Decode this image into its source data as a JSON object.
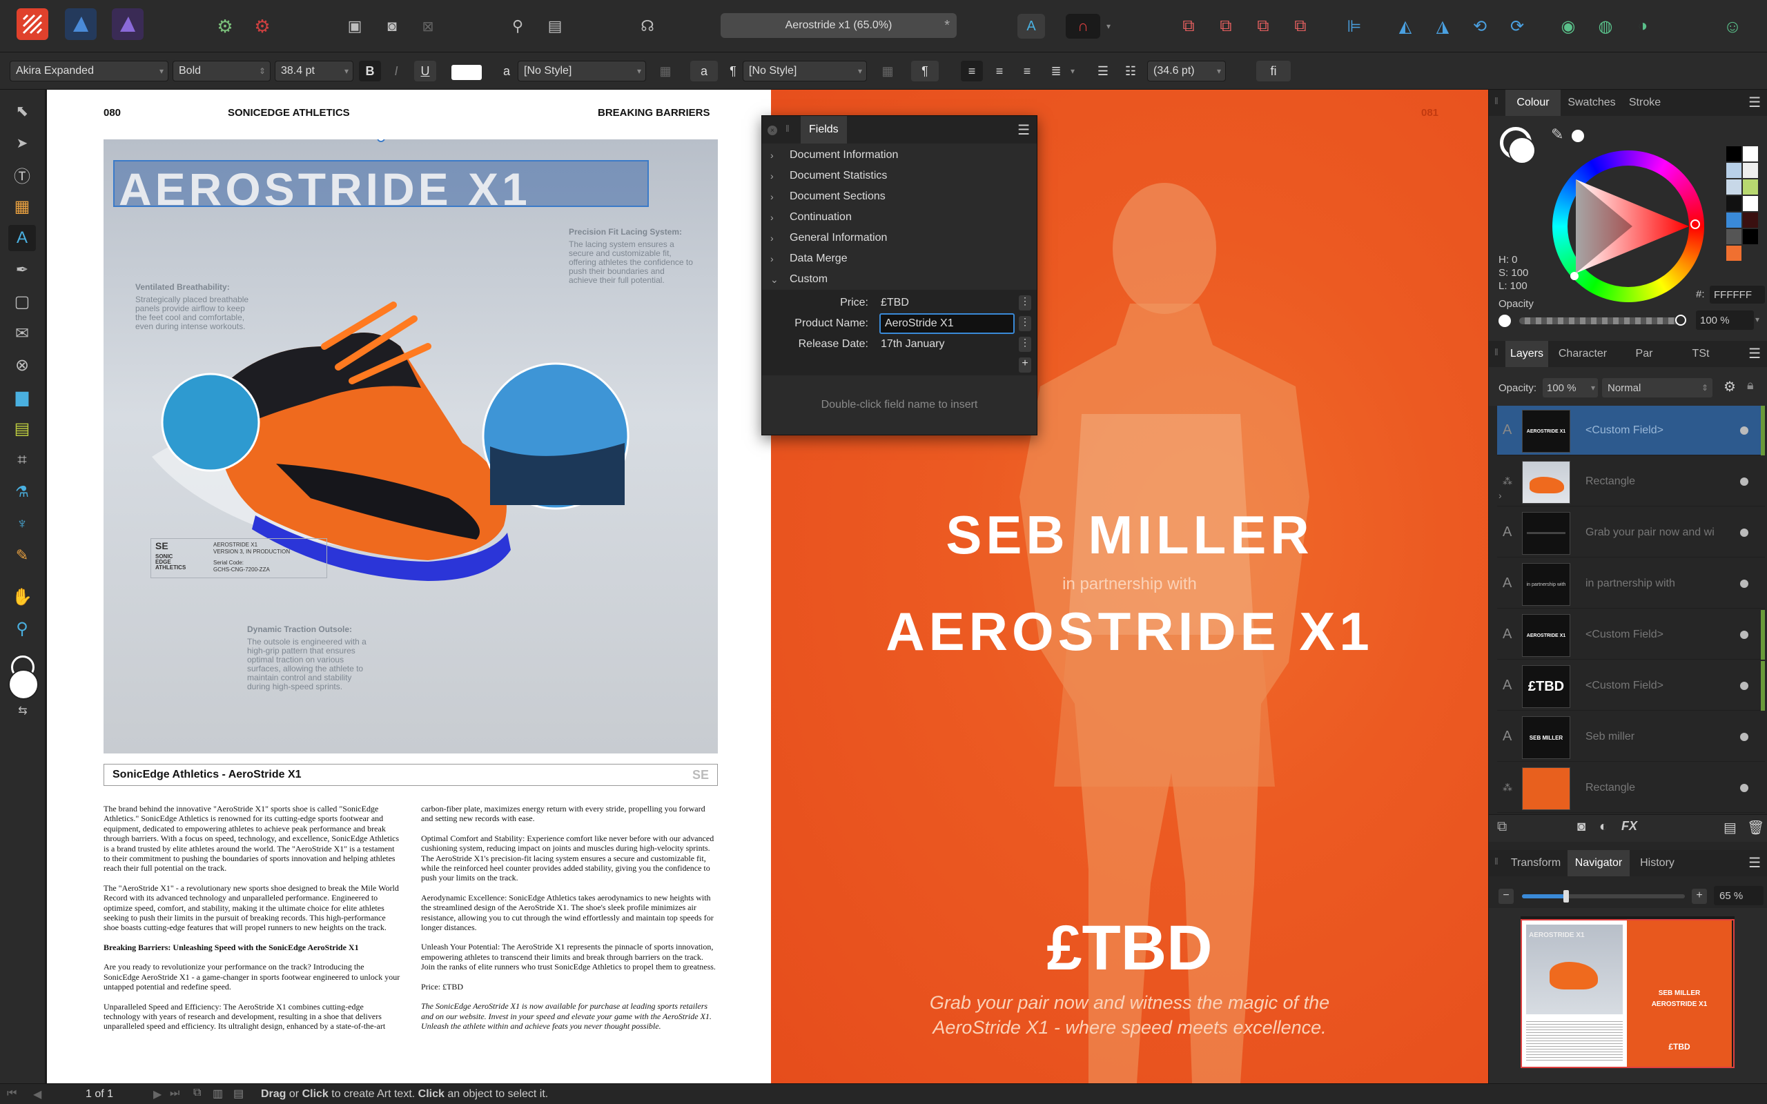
{
  "app": {
    "doc_title": "Aerostride x1 (65.0%)"
  },
  "context": {
    "font": "Akira Expanded",
    "weight": "Bold",
    "size": "38.4 pt",
    "char_style": "[No Style]",
    "para_style": "[No Style]",
    "leading": "(34.6 pt)",
    "bold": "B",
    "italic": "I",
    "underline": "U",
    "a_glyph": "a",
    "pilcrow": "¶",
    "fi": "fi"
  },
  "page_left": {
    "page_num": "080",
    "brand": "SONICEDGE ATHLETICS",
    "section": "BREAKING BARRIERS",
    "hero_title": "AEROSTRIDE X1",
    "callouts": [
      {
        "title": "Ventilated Breathability:",
        "body": "Strategically placed breathable panels provide airflow to keep the feet cool and comfortable, even during intense workouts."
      },
      {
        "title": "Precision Fit Lacing System:",
        "body": "The lacing system ensures a secure and customizable fit, offering athletes the confidence to push their boundaries and achieve their full potential."
      },
      {
        "title": "Dynamic Traction Outsole:",
        "body": "The outsole is engineered with a high-grip pattern that ensures optimal traction on various surfaces, allowing the athlete to maintain control and stability during high-speed sprints."
      }
    ],
    "tag": {
      "logo": "SE",
      "brand_lines": "SONIC EDGE ATHLETICS",
      "product": "AEROSTRIDE X1",
      "version": "VERSION 3, IN PRODUCTION",
      "serial": "Serial Code:",
      "serial_val": "GCHS-CNG-7200-ZZA"
    },
    "caption": "SonicEdge Athletics - AeroStride X1",
    "caption_logo": "SE",
    "col1": [
      "The brand behind the innovative \"AeroStride X1\" sports shoe is called \"SonicEdge Athletics.\" SonicEdge Athletics is renowned for its cutting-edge sports footwear and equipment, dedicated to empowering athletes to achieve peak performance and break through barriers. With a focus on speed, technology, and excellence, SonicEdge Athletics is a brand trusted by elite athletes around the world. The \"AeroStride X1\" is a testament to their commitment to pushing the boundaries of sports innovation and helping athletes reach their full potential on the track.",
      "The \"AeroStride X1\" - a revolutionary new sports shoe designed to break the Mile World Record with its advanced technology and unparalleled performance. Engineered to optimize speed, comfort, and stability, making it the ultimate choice for elite athletes seeking to push their limits in the pursuit of breaking records. This high-performance shoe boasts cutting-edge features that will propel runners to new heights on the track."
    ],
    "col1_heading": "Breaking Barriers: Unleashing Speed with the SonicEdge AeroStride X1",
    "col1b": [
      "Are you ready to revolutionize your performance on the track? Introducing the SonicEdge AeroStride X1 - a game-changer in sports footwear engineered to unlock your untapped potential and redefine speed.",
      "Unparalleled Speed and Efficiency: The AeroStride X1 combines cutting-edge technology with years of research and development, resulting in a shoe that delivers unparalleled speed and efficiency. Its ultralight design, enhanced by a state-of-the-art"
    ],
    "col2": [
      "carbon-fiber plate, maximizes energy return with every stride, propelling you forward and setting new records with ease.",
      "Optimal Comfort and Stability: Experience comfort like never before with our advanced cushioning system, reducing impact on joints and muscles during high-velocity sprints. The AeroStride X1's precision-fit lacing system ensures a secure and customizable fit, while the reinforced heel counter provides added stability, giving you the confidence to push your limits on the track.",
      "Aerodynamic Excellence: SonicEdge Athletics takes aerodynamics to new heights with the streamlined design of the AeroStride X1. The shoe's sleek profile minimizes air resistance, allowing you to cut through the wind effortlessly and maintain top speeds for longer distances.",
      "Unleash Your Potential: The AeroStride X1 represents the pinnacle of sports innovation, empowering athletes to transcend their limits and break through barriers on the track. Join the ranks of elite runners who trust SonicEdge Athletics to propel them to greatness.",
      "Price: £TBD"
    ],
    "col2_italic": "The SonicEdge AeroStride X1 is now available for purchase at leading sports retailers and on our website. Invest in your speed and elevate your game with the AeroStride X1. Unleash the athlete within and achieve feats you never thought possible."
  },
  "page_right": {
    "page_num": "081",
    "athlete": "SEB MILLER",
    "partner": "in partnership with",
    "product": "AEROSTRIDE X1",
    "price": "£TBD",
    "tagline1": "Grab your pair now and witness the magic of the",
    "tagline2": "AeroStride X1 - where speed meets excellence."
  },
  "fields_panel": {
    "title": "Fields",
    "items": [
      "Document Information",
      "Document Statistics",
      "Document Sections",
      "Continuation",
      "General Information",
      "Data Merge",
      "Custom"
    ],
    "custom": [
      {
        "label": "Price:",
        "value": "£TBD"
      },
      {
        "label": "Product Name:",
        "value": "AeroStride X1"
      },
      {
        "label": "Release Date:",
        "value": "17th January"
      }
    ],
    "hint": "Double-click field name to insert"
  },
  "colour_panel": {
    "tabs": [
      "Colour",
      "Swatches",
      "Stroke"
    ],
    "h": "H: 0",
    "s": "S: 100",
    "l": "L: 100",
    "opacity_label": "Opacity",
    "opacity": "100 %",
    "hex_label": "#:",
    "hex": "FFFFFF",
    "accent": "#ff3333"
  },
  "layers_panel": {
    "tabs": [
      "Layers",
      "Character",
      "Par",
      "TSt"
    ],
    "opacity_label": "Opacity:",
    "opacity": "100 %",
    "blend": "Normal",
    "layers": [
      {
        "type": "A",
        "name": "<Custom Field>",
        "thumb": "AEROSTRIDE X1",
        "selected": true,
        "bar": true
      },
      {
        "type": "group",
        "name": "Rectangle",
        "thumb": "",
        "selected": false,
        "bar": false
      },
      {
        "type": "A",
        "name": "Grab your pair now and wi",
        "thumb": "",
        "selected": false,
        "bar": false
      },
      {
        "type": "A",
        "name": "in partnership with",
        "thumb": "in partnership with",
        "selected": false,
        "bar": false
      },
      {
        "type": "A",
        "name": "<Custom Field>",
        "thumb": "AEROSTRIDE X1",
        "selected": false,
        "bar": true
      },
      {
        "type": "A",
        "name": "<Custom Field>",
        "thumb": "£TBD",
        "selected": false,
        "bar": true
      },
      {
        "type": "A",
        "name": "Seb miller",
        "thumb": "SEB MILLER",
        "selected": false,
        "bar": false
      },
      {
        "type": "group",
        "name": "Rectangle",
        "thumb": "",
        "selected": false,
        "bar": false
      }
    ]
  },
  "nav_panel": {
    "tabs": [
      "Transform",
      "Navigator",
      "History"
    ],
    "zoom": "65 %",
    "nav_left_title": "AEROSTRIDE X1",
    "nav_right_l1": "SEB MILLER",
    "nav_right_l2": "AEROSTRIDE X1",
    "nav_right_price": "£TBD"
  },
  "status": {
    "page": "1 of 1",
    "hint_b1": "Drag",
    "hint_m1": " or ",
    "hint_b2": "Click",
    "hint_m2": " to create Art text. ",
    "hint_b3": "Click",
    "hint_m3": " an object to select it."
  }
}
